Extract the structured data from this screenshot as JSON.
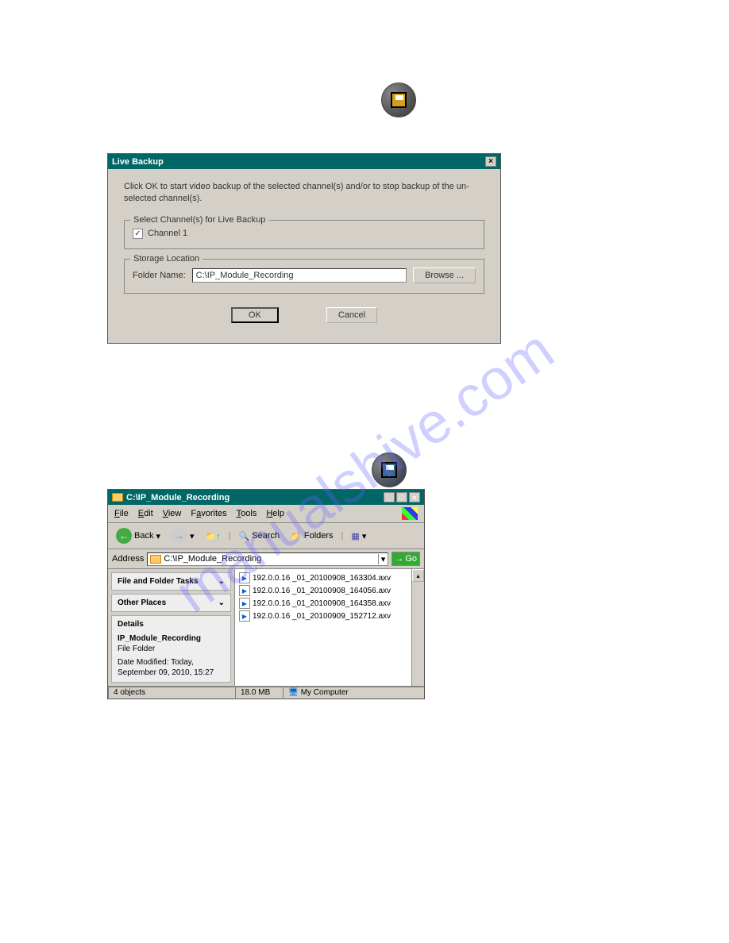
{
  "watermark": "manualshive.com",
  "dialog": {
    "title": "Live Backup",
    "close": "×",
    "instruction": "Click OK to start video backup of the selected channel(s) and/or to stop backup of the un-selected channel(s).",
    "group1_legend": "Select Channel(s) for Live Backup",
    "channel1": "Channel 1",
    "group2_legend": "Storage Location",
    "folder_label": "Folder Name:",
    "folder_value": "C:\\IP_Module_Recording",
    "browse": "Browse ...",
    "ok": "OK",
    "cancel": "Cancel"
  },
  "explorer": {
    "title": "C:\\IP_Module_Recording",
    "minimize": "_",
    "maximize": "□",
    "close": "×",
    "menu": {
      "file": "File",
      "edit": "Edit",
      "view": "View",
      "favorites": "Favorites",
      "tools": "Tools",
      "help": "Help"
    },
    "toolbar": {
      "back": "Back",
      "search": "Search",
      "folders": "Folders"
    },
    "address_label": "Address",
    "address_value": "C:\\IP_Module_Recording",
    "go": "Go",
    "tasks": {
      "file_folder": "File and Folder Tasks",
      "other_places": "Other Places",
      "details": "Details",
      "details_name": "IP_Module_Recording",
      "details_type": "File Folder",
      "details_modified": "Date Modified: Today, September 09, 2010, 15:27"
    },
    "files": [
      "192.0.0.16 _01_20100908_163304.axv",
      "192.0.0.16 _01_20100908_164056.axv",
      "192.0.0.16 _01_20100908_164358.axv",
      "192.0.0.16 _01_20100909_152712.axv"
    ],
    "status": {
      "objects": "4 objects",
      "size": "18.0 MB",
      "location": "My Computer"
    }
  }
}
